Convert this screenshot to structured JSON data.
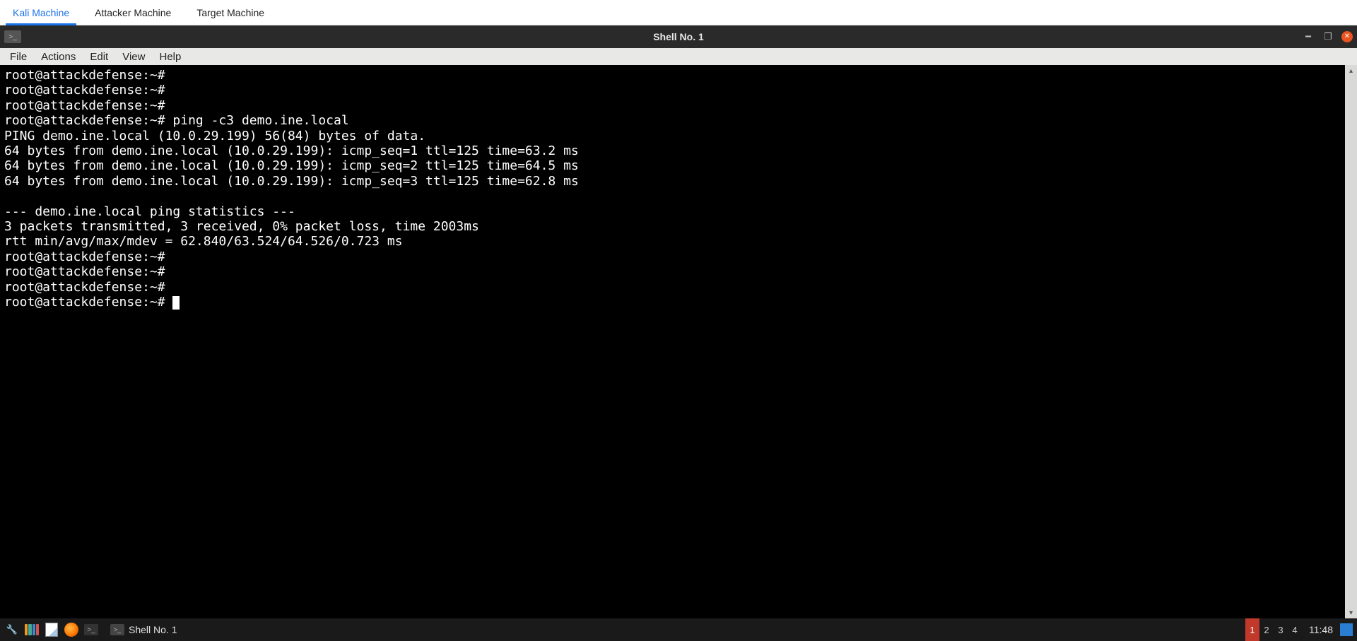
{
  "top_tabs": {
    "items": [
      {
        "label": "Kali Machine",
        "active": true
      },
      {
        "label": "Attacker Machine",
        "active": false
      },
      {
        "label": "Target Machine",
        "active": false
      }
    ]
  },
  "window": {
    "title": "Shell No. 1"
  },
  "menubar": {
    "items": [
      "File",
      "Actions",
      "Edit",
      "View",
      "Help"
    ]
  },
  "terminal": {
    "prompt": "root@attackdefense:~#",
    "lines": [
      "root@attackdefense:~#",
      "root@attackdefense:~#",
      "root@attackdefense:~#",
      "root@attackdefense:~# ping -c3 demo.ine.local",
      "PING demo.ine.local (10.0.29.199) 56(84) bytes of data.",
      "64 bytes from demo.ine.local (10.0.29.199): icmp_seq=1 ttl=125 time=63.2 ms",
      "64 bytes from demo.ine.local (10.0.29.199): icmp_seq=2 ttl=125 time=64.5 ms",
      "64 bytes from demo.ine.local (10.0.29.199): icmp_seq=3 ttl=125 time=62.8 ms",
      "",
      "--- demo.ine.local ping statistics ---",
      "3 packets transmitted, 3 received, 0% packet loss, time 2003ms",
      "rtt min/avg/max/mdev = 62.840/63.524/64.526/0.723 ms",
      "root@attackdefense:~#",
      "root@attackdefense:~#",
      "root@attackdefense:~#",
      "root@attackdefense:~# "
    ]
  },
  "taskbar": {
    "app_label": "Shell No. 1",
    "workspaces": [
      "1",
      "2",
      "3",
      "4"
    ],
    "active_workspace": 0,
    "clock": "11:48"
  }
}
